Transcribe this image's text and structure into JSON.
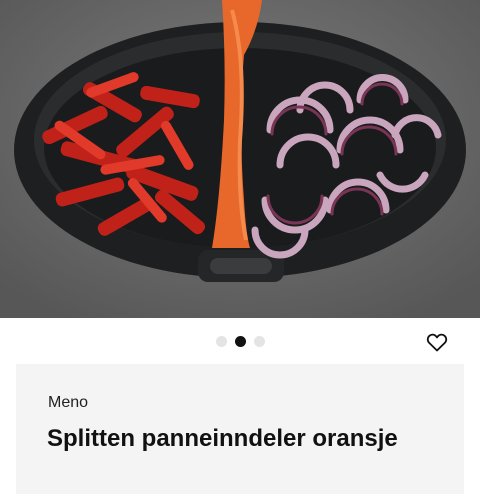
{
  "product": {
    "brand": "Meno",
    "title": "Splitten panneinndeler oransje"
  },
  "gallery": {
    "dot_count": 3,
    "active_index": 1
  },
  "icons": {
    "favorite": "heart-outline-icon"
  },
  "colors": {
    "accent": "#e8672a",
    "active_dot": "#111111",
    "inactive_dot": "#e4e4e4",
    "card_background": "#f4f4f4"
  }
}
